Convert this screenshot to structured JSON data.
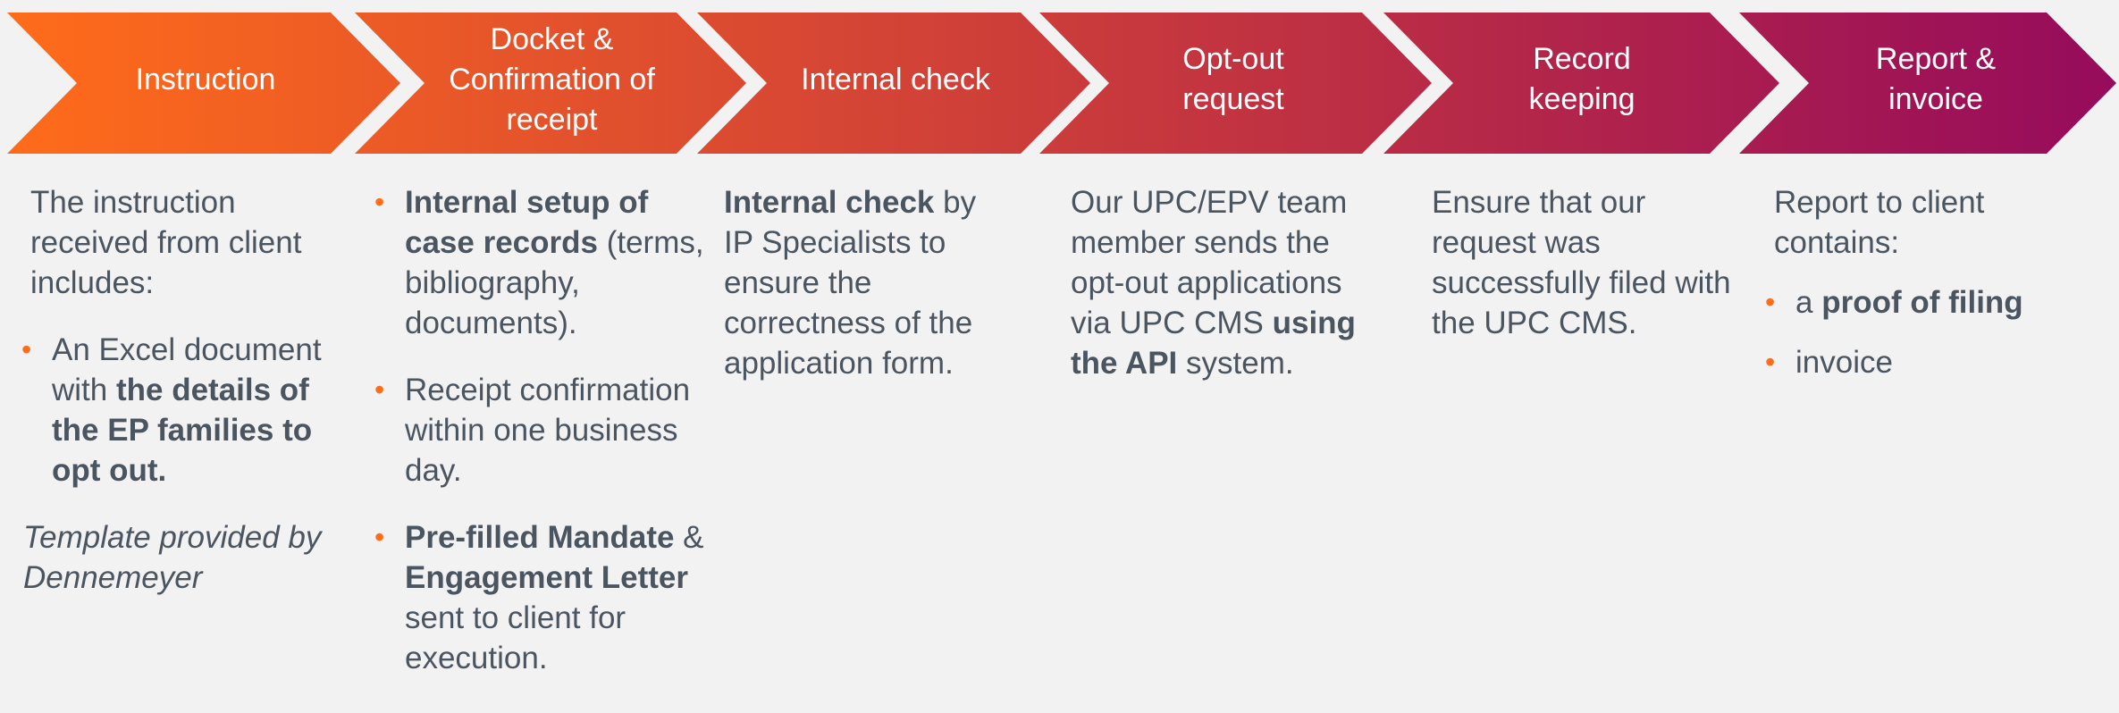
{
  "colors": {
    "gradient_start": "#ff6c1a",
    "gradient_end": "#960b5c",
    "text": "#4a5560",
    "bullet": "#ff6c1a"
  },
  "steps": [
    {
      "label": "Instruction"
    },
    {
      "label": "Docket &\nConfirmation of\nreceipt"
    },
    {
      "label": "Internal check"
    },
    {
      "label": "Opt-out\nrequest"
    },
    {
      "label": "Record\nkeeping"
    },
    {
      "label": "Report &\ninvoice"
    }
  ],
  "col1": {
    "intro": "The instruction received from client includes:",
    "b1_pre": "An Excel document with ",
    "b1_bold": "the details of the EP families to opt out.",
    "note": "Template provided by Dennemeyer"
  },
  "col2": {
    "b1_bold": "Internal setup of case records",
    "b1_rest": " (terms, bibliography, documents).",
    "b2": "Receipt confirmation within one business day.",
    "b3_bold1": "Pre-filled Mandate",
    "b3_mid": " & ",
    "b3_bold2": "Engagement Letter",
    "b3_rest": " sent to client for execution."
  },
  "col3": {
    "bold": "Internal check",
    "rest": " by IP Specialists to ensure the correctness of the application form."
  },
  "col4": {
    "pre": "Our UPC/EPV team member sends the opt-out applications via UPC CMS ",
    "bold": "using the API",
    "rest": " system."
  },
  "col5": {
    "text": "Ensure that our request was successfully filed with the UPC CMS."
  },
  "col6": {
    "intro": "Report to client contains:",
    "b1_pre": "a ",
    "b1_bold": "proof of filing",
    "b2": "invoice"
  }
}
